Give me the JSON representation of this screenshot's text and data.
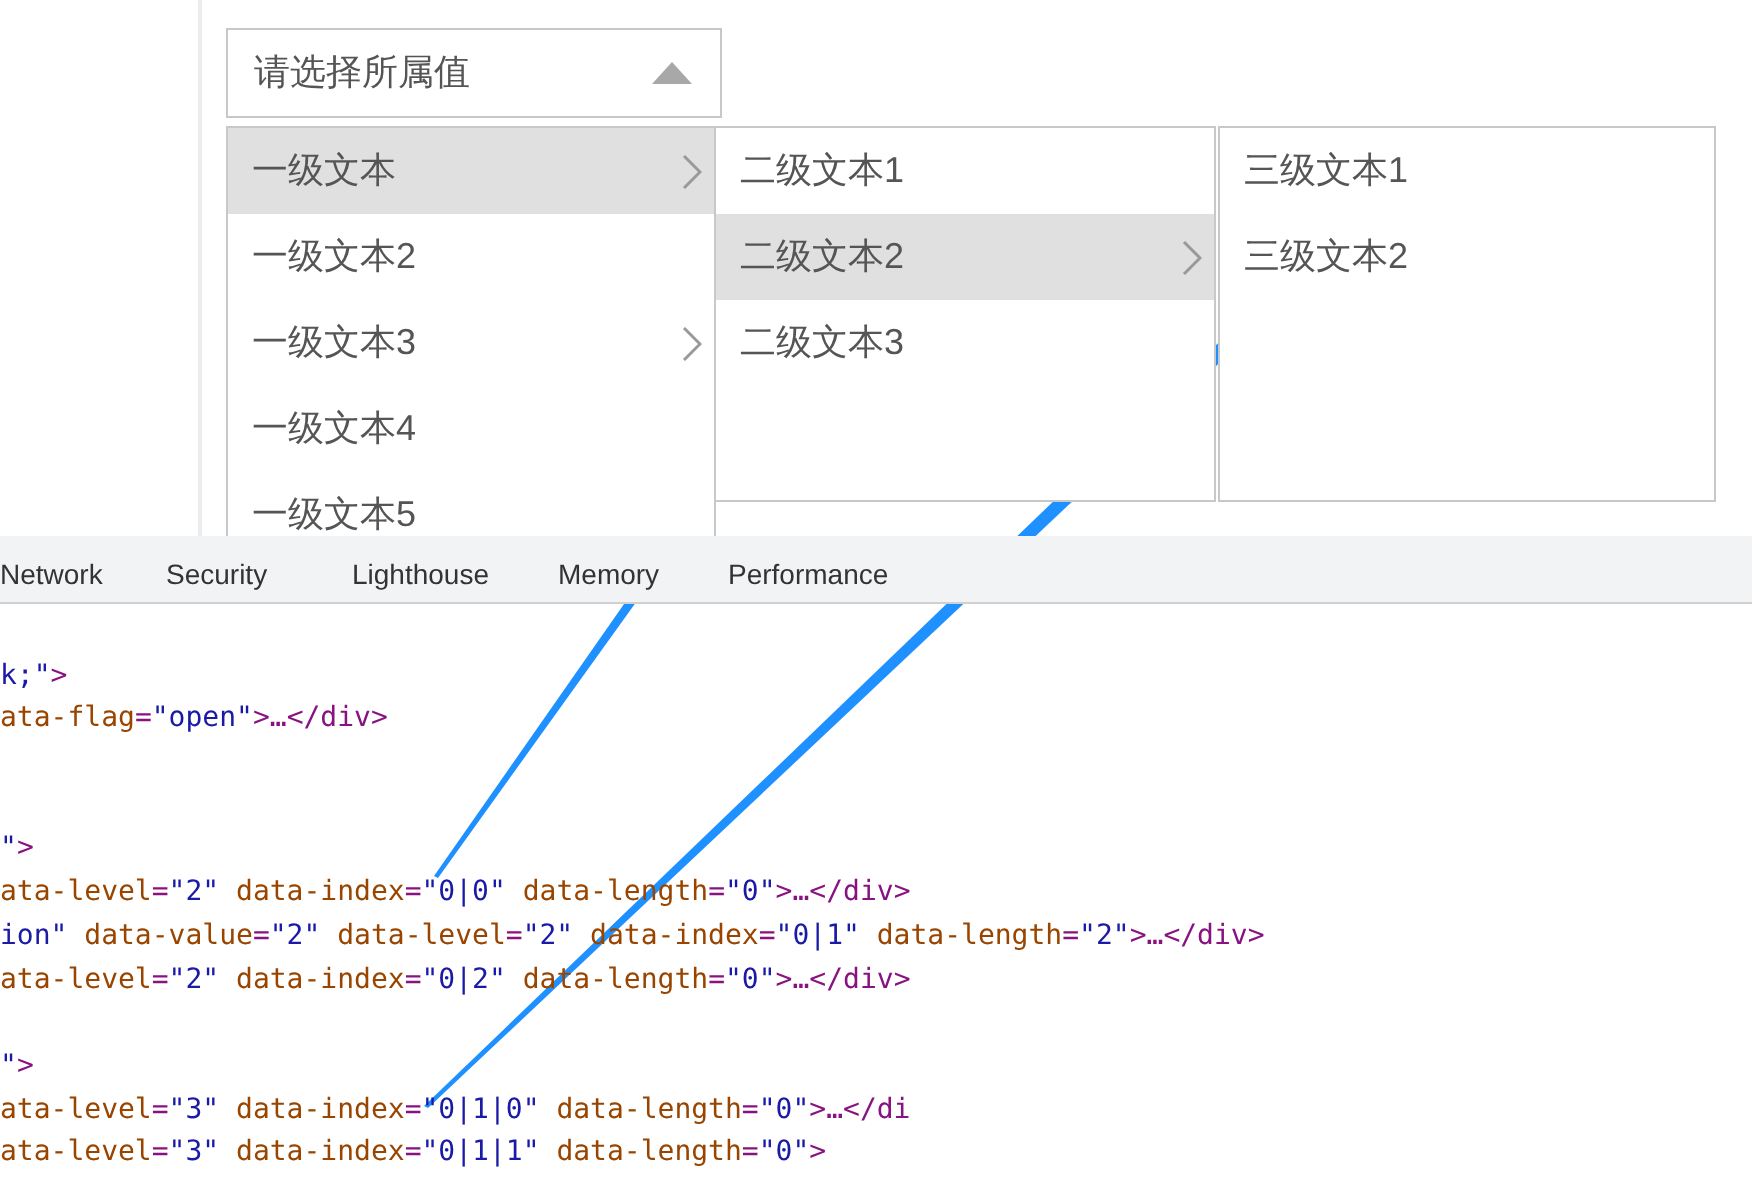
{
  "select": {
    "placeholder": "请选择所属值",
    "open": true
  },
  "cascader": {
    "columns": [
      {
        "items": [
          {
            "label": "一级文本",
            "has_children": true,
            "selected": true
          },
          {
            "label": "一级文本2",
            "has_children": false,
            "selected": false
          },
          {
            "label": "一级文本3",
            "has_children": true,
            "selected": false
          },
          {
            "label": "一级文本4",
            "has_children": false,
            "selected": false
          },
          {
            "label": "一级文本5",
            "has_children": false,
            "selected": false
          }
        ]
      },
      {
        "items": [
          {
            "label": "二级文本1",
            "has_children": false,
            "selected": false
          },
          {
            "label": "二级文本2",
            "has_children": true,
            "selected": true
          },
          {
            "label": "二级文本3",
            "has_children": false,
            "selected": false
          }
        ]
      },
      {
        "items": [
          {
            "label": "三级文本1",
            "has_children": false,
            "selected": false
          },
          {
            "label": "三级文本2",
            "has_children": false,
            "selected": false
          }
        ]
      }
    ]
  },
  "devtools": {
    "tabs": [
      "Network",
      "Security",
      "Lighthouse",
      "Memory",
      "Performance"
    ],
    "code_lines": [
      {
        "kind": "blank"
      },
      {
        "kind": "code",
        "tokens": [
          {
            "kind": "value",
            "text": "k;\""
          },
          {
            "kind": "punct",
            "text": ">"
          }
        ]
      },
      {
        "kind": "code",
        "tokens": [
          {
            "kind": "attr",
            "text": "ata-flag"
          },
          {
            "kind": "punct",
            "text": "="
          },
          {
            "kind": "value",
            "text": "\"open\""
          },
          {
            "kind": "punct",
            "text": ">…"
          },
          {
            "kind": "tag",
            "text": "</div"
          },
          {
            "kind": "punct",
            "text": ">"
          }
        ]
      },
      {
        "kind": "blank"
      },
      {
        "kind": "blank"
      },
      {
        "kind": "code",
        "tokens": [
          {
            "kind": "value",
            "text": "\""
          },
          {
            "kind": "punct",
            "text": ">"
          }
        ]
      },
      {
        "kind": "code",
        "tokens": [
          {
            "kind": "attr",
            "text": "ata-level"
          },
          {
            "kind": "punct",
            "text": "="
          },
          {
            "kind": "value",
            "text": "\"2\""
          },
          {
            "kind": "attr",
            "text": " data-index"
          },
          {
            "kind": "punct",
            "text": "="
          },
          {
            "kind": "value",
            "text": "\"0|0\""
          },
          {
            "kind": "attr",
            "text": " data-length"
          },
          {
            "kind": "punct",
            "text": "="
          },
          {
            "kind": "value",
            "text": "\"0\""
          },
          {
            "kind": "punct",
            "text": ">…"
          },
          {
            "kind": "tag",
            "text": "</div"
          },
          {
            "kind": "punct",
            "text": ">"
          }
        ]
      },
      {
        "kind": "code",
        "tokens": [
          {
            "kind": "value",
            "text": "ion\""
          },
          {
            "kind": "attr",
            "text": " data-value"
          },
          {
            "kind": "punct",
            "text": "="
          },
          {
            "kind": "value",
            "text": "\"2\""
          },
          {
            "kind": "attr",
            "text": " data-level"
          },
          {
            "kind": "punct",
            "text": "="
          },
          {
            "kind": "value",
            "text": "\"2\""
          },
          {
            "kind": "attr",
            "text": " data-index"
          },
          {
            "kind": "punct",
            "text": "="
          },
          {
            "kind": "value",
            "text": "\"0|1\""
          },
          {
            "kind": "attr",
            "text": " data-length"
          },
          {
            "kind": "punct",
            "text": "="
          },
          {
            "kind": "value",
            "text": "\"2\""
          },
          {
            "kind": "punct",
            "text": ">…"
          },
          {
            "kind": "tag",
            "text": "</div"
          },
          {
            "kind": "punct",
            "text": ">"
          }
        ]
      },
      {
        "kind": "code",
        "tokens": [
          {
            "kind": "attr",
            "text": "ata-level"
          },
          {
            "kind": "punct",
            "text": "="
          },
          {
            "kind": "value",
            "text": "\"2\""
          },
          {
            "kind": "attr",
            "text": " data-index"
          },
          {
            "kind": "punct",
            "text": "="
          },
          {
            "kind": "value",
            "text": "\"0|2\""
          },
          {
            "kind": "attr",
            "text": " data-length"
          },
          {
            "kind": "punct",
            "text": "="
          },
          {
            "kind": "value",
            "text": "\"0\""
          },
          {
            "kind": "punct",
            "text": ">…"
          },
          {
            "kind": "tag",
            "text": "</div"
          },
          {
            "kind": "punct",
            "text": ">"
          }
        ]
      },
      {
        "kind": "blank"
      },
      {
        "kind": "code",
        "tokens": [
          {
            "kind": "value",
            "text": "\""
          },
          {
            "kind": "punct",
            "text": ">"
          }
        ]
      },
      {
        "kind": "code",
        "tokens": [
          {
            "kind": "attr",
            "text": "ata-level"
          },
          {
            "kind": "punct",
            "text": "="
          },
          {
            "kind": "value",
            "text": "\"3\""
          },
          {
            "kind": "attr",
            "text": " data-index"
          },
          {
            "kind": "punct",
            "text": "="
          },
          {
            "kind": "value",
            "text": "\"0|1|0\""
          },
          {
            "kind": "attr",
            "text": " data-length"
          },
          {
            "kind": "punct",
            "text": "="
          },
          {
            "kind": "value",
            "text": "\"0\""
          },
          {
            "kind": "punct",
            "text": ">…"
          },
          {
            "kind": "tag",
            "text": "</di"
          }
        ]
      },
      {
        "kind": "code",
        "tokens": [
          {
            "kind": "attr",
            "text": "ata-level"
          },
          {
            "kind": "punct",
            "text": "="
          },
          {
            "kind": "value",
            "text": "\"3\""
          },
          {
            "kind": "attr",
            "text": " data-index"
          },
          {
            "kind": "punct",
            "text": "="
          },
          {
            "kind": "value",
            "text": "\"0|1|1\""
          },
          {
            "kind": "attr",
            "text": " data-length"
          },
          {
            "kind": "punct",
            "text": "="
          },
          {
            "kind": "value",
            "text": "\"0\""
          },
          {
            "kind": "punct",
            "text": ">"
          }
        ]
      }
    ]
  }
}
